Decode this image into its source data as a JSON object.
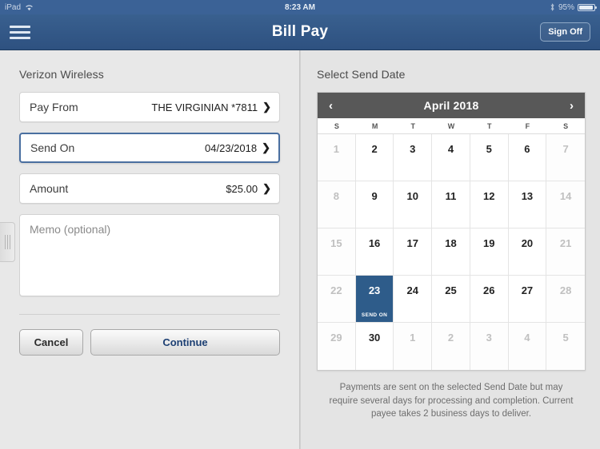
{
  "statusbar": {
    "device": "iPad",
    "wifi_icon": "wifi-icon",
    "time": "8:23 AM",
    "bluetooth_icon": "bluetooth-icon",
    "battery_percent": "95%"
  },
  "navbar": {
    "menu_icon": "hamburger-menu-icon",
    "title": "Bill Pay",
    "signoff_label": "Sign Off"
  },
  "left_pane": {
    "payee_label": "Verizon Wireless",
    "fields": [
      {
        "label": "Pay From",
        "value": "THE VIRGINIAN *7811",
        "chevron": "❯",
        "focused": false
      },
      {
        "label": "Send On",
        "value": "04/23/2018",
        "chevron": "❯",
        "focused": true
      },
      {
        "label": "Amount",
        "value": "$25.00",
        "chevron": "❯",
        "focused": false
      }
    ],
    "memo_placeholder": "Memo (optional)",
    "cancel_label": "Cancel",
    "continue_label": "Continue"
  },
  "right_pane": {
    "section_label": "Select Send Date",
    "calendar": {
      "prev_icon": "‹",
      "next_icon": "›",
      "title": "April 2018",
      "dow": [
        "S",
        "M",
        "T",
        "W",
        "T",
        "F",
        "S"
      ],
      "selected_badge": "SEND ON",
      "days": [
        {
          "n": "1",
          "dim": true
        },
        {
          "n": "2",
          "dim": false
        },
        {
          "n": "3",
          "dim": false
        },
        {
          "n": "4",
          "dim": false
        },
        {
          "n": "5",
          "dim": false
        },
        {
          "n": "6",
          "dim": false
        },
        {
          "n": "7",
          "dim": true
        },
        {
          "n": "8",
          "dim": true
        },
        {
          "n": "9",
          "dim": false
        },
        {
          "n": "10",
          "dim": false
        },
        {
          "n": "11",
          "dim": false
        },
        {
          "n": "12",
          "dim": false
        },
        {
          "n": "13",
          "dim": false
        },
        {
          "n": "14",
          "dim": true
        },
        {
          "n": "15",
          "dim": true
        },
        {
          "n": "16",
          "dim": false
        },
        {
          "n": "17",
          "dim": false
        },
        {
          "n": "18",
          "dim": false
        },
        {
          "n": "19",
          "dim": false
        },
        {
          "n": "20",
          "dim": false
        },
        {
          "n": "21",
          "dim": true
        },
        {
          "n": "22",
          "dim": true
        },
        {
          "n": "23",
          "dim": false,
          "selected": true
        },
        {
          "n": "24",
          "dim": false
        },
        {
          "n": "25",
          "dim": false
        },
        {
          "n": "26",
          "dim": false
        },
        {
          "n": "27",
          "dim": false
        },
        {
          "n": "28",
          "dim": true
        },
        {
          "n": "29",
          "dim": true
        },
        {
          "n": "30",
          "dim": false
        },
        {
          "n": "1",
          "dim": true
        },
        {
          "n": "2",
          "dim": true
        },
        {
          "n": "3",
          "dim": true
        },
        {
          "n": "4",
          "dim": true
        },
        {
          "n": "5",
          "dim": true
        }
      ]
    },
    "note": "Payments are sent on the selected Send Date but may require several days for processing and completion. Current payee takes 2 business days to deliver."
  },
  "colors": {
    "navbar": "#2e5180",
    "selected_day": "#2e5c8a",
    "calendar_header": "#585858",
    "continue_text": "#1c3f73"
  }
}
